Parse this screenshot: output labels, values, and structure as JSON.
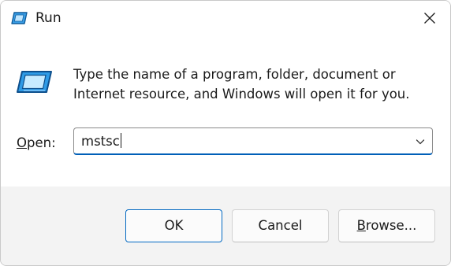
{
  "window": {
    "title": "Run",
    "close_icon": "close-icon",
    "app_icon": "run-icon"
  },
  "description": {
    "line1": "Type the name of a program, folder, document or",
    "line2": "Internet resource, and Windows will open it for you."
  },
  "open_field": {
    "label_accel": "O",
    "label_rest": "pen:",
    "value": "mstsc",
    "dropdown_icon": "chevron-down-icon"
  },
  "buttons": {
    "ok": "OK",
    "cancel": "Cancel",
    "browse_accel": "B",
    "browse_rest": "rowse..."
  },
  "colors": {
    "accent": "#005fb8",
    "footer_bg": "#f3f3f3",
    "icon_blue": "#1e90ff"
  }
}
